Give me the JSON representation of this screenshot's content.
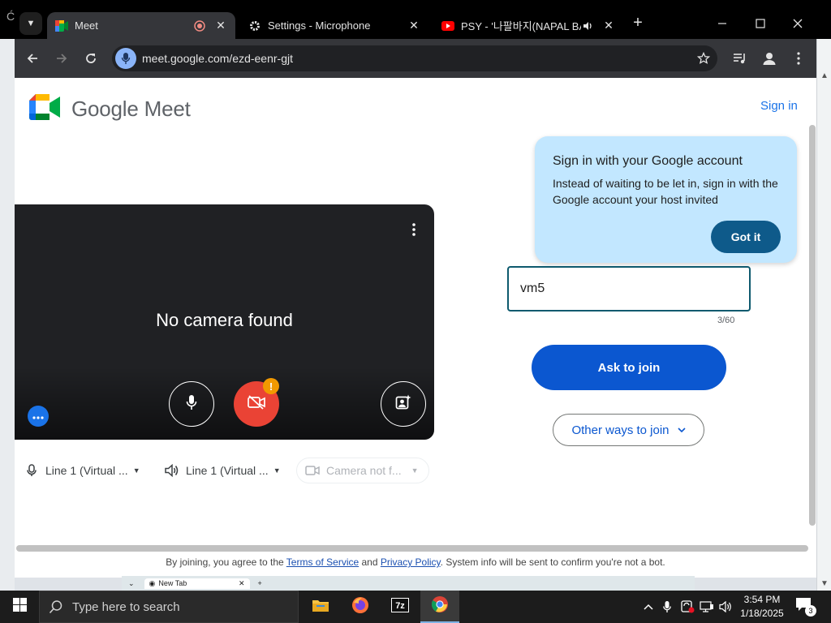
{
  "browser": {
    "tabs": [
      {
        "title": "Meet",
        "active": true
      },
      {
        "title": "Settings - Microphone",
        "active": false
      },
      {
        "title": "PSY - '나팔바지(NAPAL BA",
        "active": false
      }
    ],
    "url": "meet.google.com/ezd-eenr-gjt"
  },
  "page": {
    "brand": "Google Meet",
    "sign_in": "Sign in",
    "bubble": {
      "title": "Sign in with your Google account",
      "body": "Instead of waiting to be let in, sign in with the Google account your host invited",
      "button": "Got it"
    },
    "preview": {
      "message": "No camera found",
      "warning_badge": "!"
    },
    "devices": {
      "microphone": "Line 1 (Virtual ...",
      "speaker": "Line 1 (Virtual ...",
      "camera": "Camera not f..."
    },
    "name_input": {
      "value": "vm5",
      "counter": "3/60"
    },
    "ask_to_join": "Ask to join",
    "other_ways": "Other ways to join",
    "footer": {
      "prefix": "By joining, you agree to the ",
      "terms": "Terms of Service",
      "and": " and ",
      "privacy": "Privacy Policy",
      "suffix": ". System info will be sent to confirm you're not a bot."
    }
  },
  "behind_window": {
    "tab": "New Tab"
  },
  "taskbar": {
    "search_placeholder": "Type here to search",
    "time": "3:54 PM",
    "date": "1/18/2025",
    "notification_count": "3"
  },
  "colors": {
    "accent": "#0b57d0",
    "bubble": "#c2e7ff",
    "camera_off": "#ea4335"
  }
}
